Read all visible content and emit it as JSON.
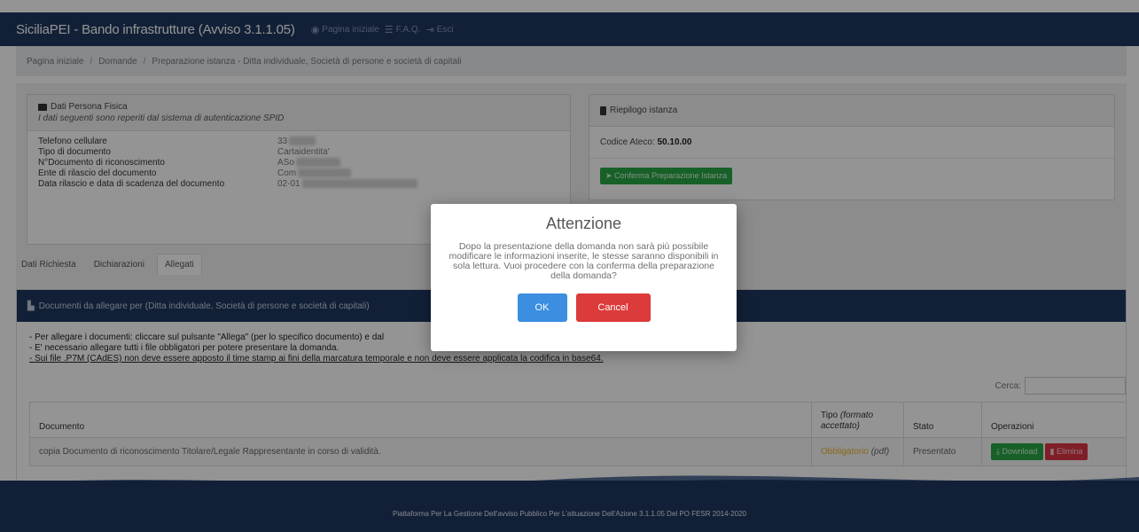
{
  "header": {
    "brand": "SiciliaPEI - Bando infrastrutture (Avviso 3.1.1.05)",
    "nav": [
      {
        "icon": "dashboard-icon",
        "glyph": "◉",
        "label": "Pagina iniziale"
      },
      {
        "icon": "list-icon",
        "glyph": "☰",
        "label": "F.A.Q."
      },
      {
        "icon": "logout-icon",
        "glyph": "⇥",
        "label": "Esci"
      }
    ]
  },
  "breadcrumb": [
    "Pagina iniziale",
    "Domande",
    "Preparazione istanza - Ditta individuale, Società di persone e società di capitali"
  ],
  "persona": {
    "title": "Dati Persona Fisica",
    "subtitle": "I dati seguenti sono reperiti dal sistema di autenticazione SPID",
    "rows": [
      {
        "label": "Telefono cellulare",
        "value": "33"
      },
      {
        "label": "Tipo di documento",
        "value": "Cartaidentita'"
      },
      {
        "label": "N°Documento di riconoscimento",
        "value": "ASo"
      },
      {
        "label": "Ente di rilascio del documento",
        "value": "Com"
      },
      {
        "label": "Data rilascio e data di scadenza del documento",
        "value": "02-01"
      }
    ]
  },
  "riepilogo": {
    "title": "Riepilogo istanza",
    "ateco_label": "Codice Ateco:",
    "ateco_value": "50.10.00",
    "confirm_button": "Conferma Preparazione Istanza"
  },
  "tabs": [
    {
      "label": "Dati Richiesta",
      "active": false
    },
    {
      "label": "Dichiarazioni",
      "active": false
    },
    {
      "label": "Allegati",
      "active": true
    }
  ],
  "documents": {
    "header": "Documenti da allegare per (Ditta individuale, Società di persone e società di capitali)",
    "notes": [
      "- Per allegare i documenti: cliccare sul pulsante \"Allega\" (per lo specifico documento) e dal",
      "- E' necessario allegare tutti i file obbligatori per potere presentare la domanda.",
      "- Sui file .P7M (CAdES) non deve essere apposto il time stamp ai fini della marcatura temporale e non deve essere applicata la codifica in base64."
    ],
    "search_label": "Cerca:",
    "columns": {
      "documento": "Documento",
      "tipo_a": "Tipo",
      "tipo_b": "(formato",
      "tipo_c": "accettato)",
      "stato": "Stato",
      "operazioni": "Operazioni"
    },
    "rows": [
      {
        "documento": "copia Documento di riconoscimento Titolare/Legale Rappresentante in corso di validità.",
        "tipo": "Obbligatorio",
        "formato": "(pdf)",
        "stato": "Presentato",
        "download": "Download",
        "elimina": "Elimina"
      }
    ]
  },
  "footer": "Piattaforma Per La Gestione Dell'avviso Pubblico Per L'attuazione Dell'Azione 3.1.1.05 Del PO FESR 2014-2020",
  "modal": {
    "title": "Attenzione",
    "text": "Dopo la presentazione della domanda non sarà più possibile modificare le informazioni inserite, le stesse saranno disponibili in sola lettura. Vuoi procedere con la conferma della preparazione della domanda?",
    "ok": "OK",
    "cancel": "Cancel"
  },
  "colors": {
    "navy": "#1f3760",
    "green": "#28a745",
    "red": "#dc3545",
    "ok_blue": "#3b8ee0"
  }
}
